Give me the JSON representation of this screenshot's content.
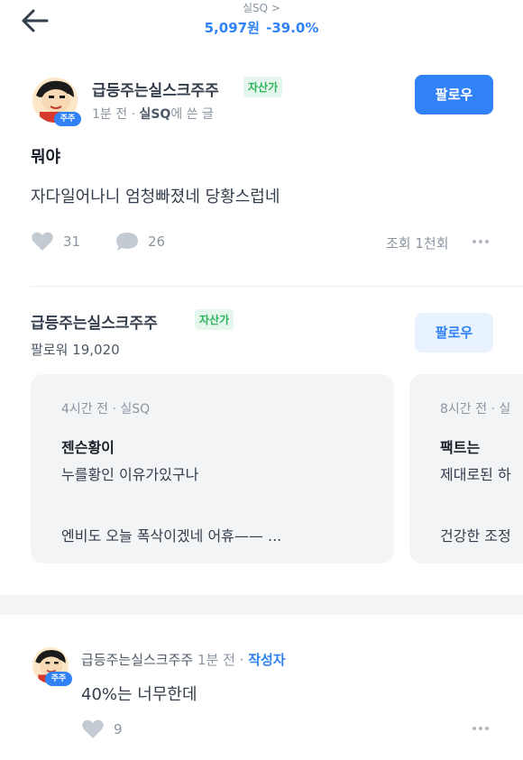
{
  "header": {
    "stock_name": "실SQ >",
    "price": "5,097원",
    "change": "-39.0%"
  },
  "post": {
    "author": "급등주는실스크주주",
    "author_tag": "자산가",
    "avatar_badge": "주주",
    "meta_time": "1분 전 · ",
    "meta_stock": "실SQ",
    "meta_suffix": "에 쓴 글",
    "follow_label": "팔로우",
    "title": "뭐야",
    "body": "자다일어나니 엄청빠졌네 당황스럽네",
    "likes": "31",
    "comments": "26",
    "views": "조회 1천회"
  },
  "profile": {
    "name": "급등주는실스크주주",
    "tag": "자산가",
    "followers": "팔로워 19,020",
    "follow_label": "팔로우"
  },
  "cards": [
    {
      "meta": "4시간 전 · 실SQ",
      "title": "젠슨황이",
      "line1": "누를황인 이유가있구나",
      "line2": "엔비도 오늘 폭삭이겠네 어휴—— ..."
    },
    {
      "meta": "8시간 전 · 실",
      "title": "팩트는",
      "line1": "제대로된 하",
      "line2": "건강한 조정"
    }
  ],
  "comment": {
    "author": "급등주는실스크주주",
    "time": " 1분 전 · ",
    "author_label": "작성자",
    "avatar_badge": "주주",
    "body": "40%는 너무한데",
    "likes": "9"
  },
  "colors": {
    "accent": "#3182f6",
    "asset_tag": "#2db35d",
    "card_bg": "#f2f4f6"
  },
  "icons": [
    "back-arrow-icon",
    "heart-icon",
    "comment-bubble-icon",
    "more-dots-icon"
  ]
}
